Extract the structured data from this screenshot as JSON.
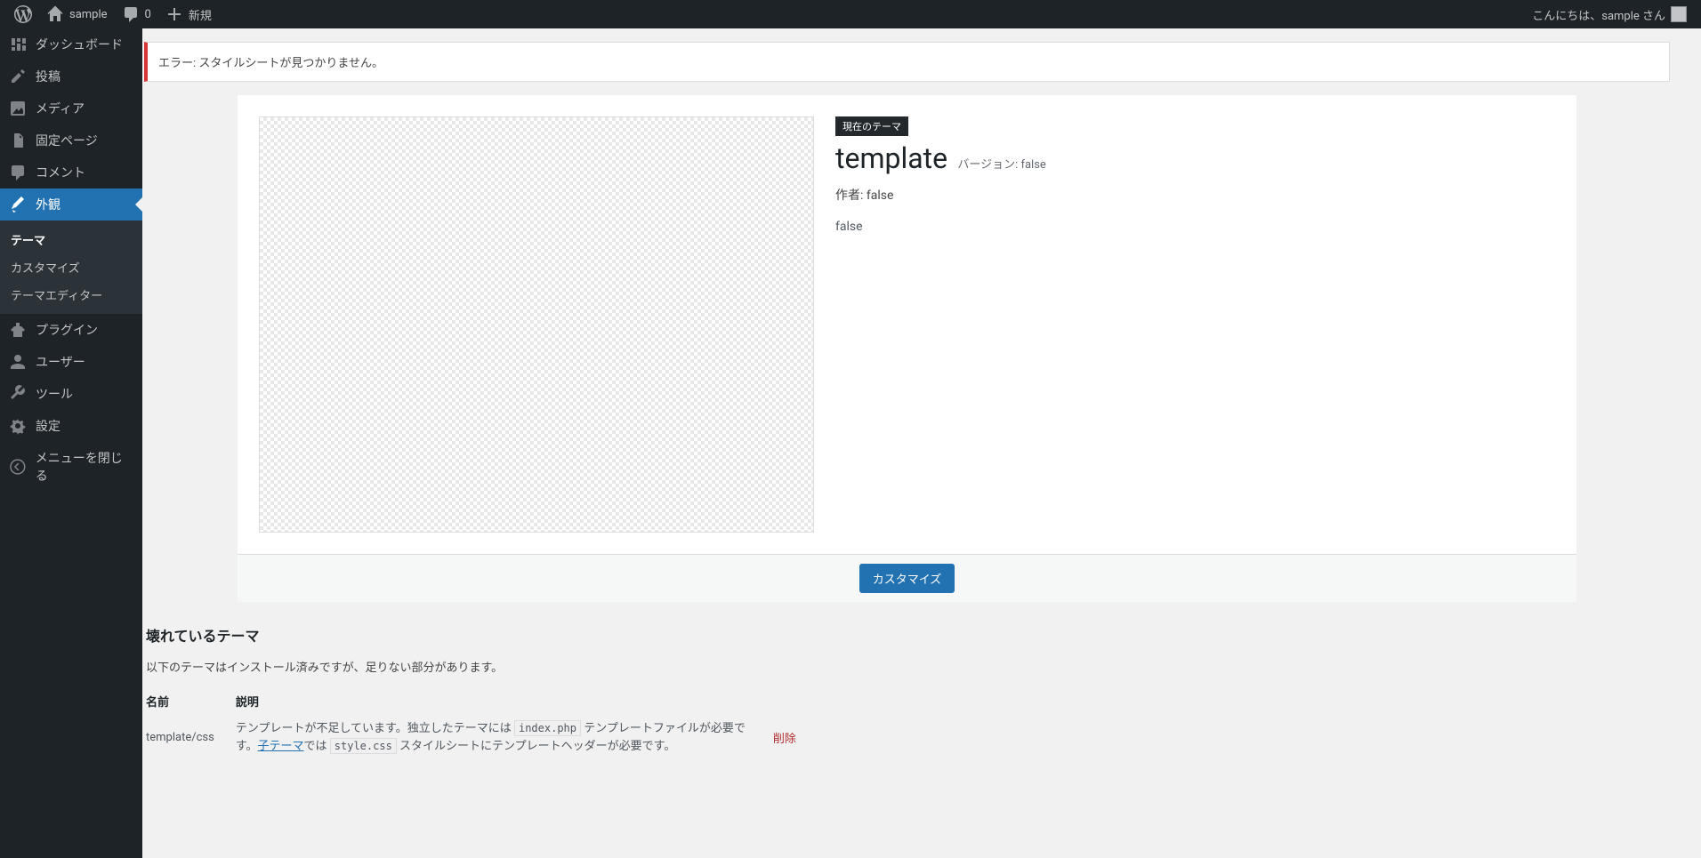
{
  "toolbar": {
    "site_name": "sample",
    "comment_count": "0",
    "new_label": "新規",
    "greeting": "こんにちは、sample さん"
  },
  "menu": {
    "dashboard": "ダッシュボード",
    "posts": "投稿",
    "media": "メディア",
    "pages": "固定ページ",
    "comments": "コメント",
    "appearance": "外観",
    "appearance_sub": {
      "themes": "テーマ",
      "customize": "カスタマイズ",
      "editor": "テーマエディター"
    },
    "plugins": "プラグイン",
    "users": "ユーザー",
    "tools": "ツール",
    "settings": "設定",
    "collapse": "メニューを閉じる"
  },
  "notice": {
    "error": "エラー: スタイルシートが見つかりません。"
  },
  "theme": {
    "current_label": "現在のテーマ",
    "name": "template",
    "version_label": "バージョン: false",
    "author_label": "作者: false",
    "description": "false",
    "customize_button": "カスタマイズ"
  },
  "broken": {
    "heading": "壊れているテーマ",
    "intro": "以下のテーマはインストール済みですが、足りない部分があります。",
    "col_name": "名前",
    "col_desc": "説明",
    "row": {
      "name": "template/css",
      "desc_a": "テンプレートが不足しています。独立したテーマには ",
      "code1": "index.php",
      "desc_b": " テンプレートファイルが必要です。",
      "child_link": "子テーマ",
      "desc_c": "では ",
      "code2": "style.css",
      "desc_d": " スタイルシートにテンプレートヘッダーが必要です。",
      "delete": "削除"
    }
  }
}
